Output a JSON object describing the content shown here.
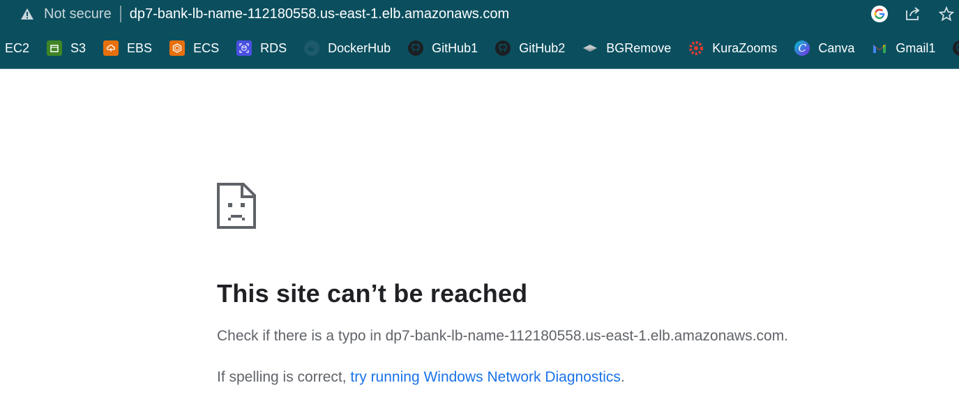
{
  "addressbar": {
    "security_label": "Not secure",
    "url": "dp7-bank-lb-name-112180558.us-east-1.elb.amazonaws.com",
    "icons": [
      "google-lens-icon",
      "share-icon",
      "star-icon"
    ]
  },
  "bookmarks": [
    {
      "label": "EC2",
      "icon": "none"
    },
    {
      "label": "S3",
      "icon": "s3-icon",
      "color": "#3f8624"
    },
    {
      "label": "EBS",
      "icon": "ebs-icon",
      "color": "#e8700c"
    },
    {
      "label": "ECS",
      "icon": "ecs-icon",
      "color": "#e8700c"
    },
    {
      "label": "RDS",
      "icon": "rds-icon",
      "color": "#4a50e0"
    },
    {
      "label": "DockerHub",
      "icon": "docker-icon",
      "color": "#1d5a6b"
    },
    {
      "label": "GitHub1",
      "icon": "github-icon",
      "color": "#1b1f23"
    },
    {
      "label": "GitHub2",
      "icon": "github-icon",
      "color": "#1b1f23"
    },
    {
      "label": "BGRemove",
      "icon": "bgremove-icon",
      "color": "#9aa3a6"
    },
    {
      "label": "KuraZooms",
      "icon": "kurazooms-icon",
      "color": "#e03c31"
    },
    {
      "label": "Canva",
      "icon": "canva-icon",
      "color": "#7d2ae8"
    },
    {
      "label": "Gmail1",
      "icon": "gmail-icon",
      "color": "#ea4335"
    }
  ],
  "error": {
    "icon": "sad-document-icon",
    "title": "This site can’t be reached",
    "typo_prefix": "Check if there is a typo in ",
    "typo_host": "dp7-bank-lb-name-112180558.us-east-1.elb.amazonaws.com",
    "typo_suffix": ".",
    "spelling_prefix": "If spelling is correct, ",
    "diagnostics_link": "try running Windows Network Diagnostics",
    "spelling_suffix": "."
  },
  "colors": {
    "toolbar": "#0b4f5f",
    "link": "#1a73e8",
    "title": "#202124",
    "body_text": "#5f6368"
  }
}
